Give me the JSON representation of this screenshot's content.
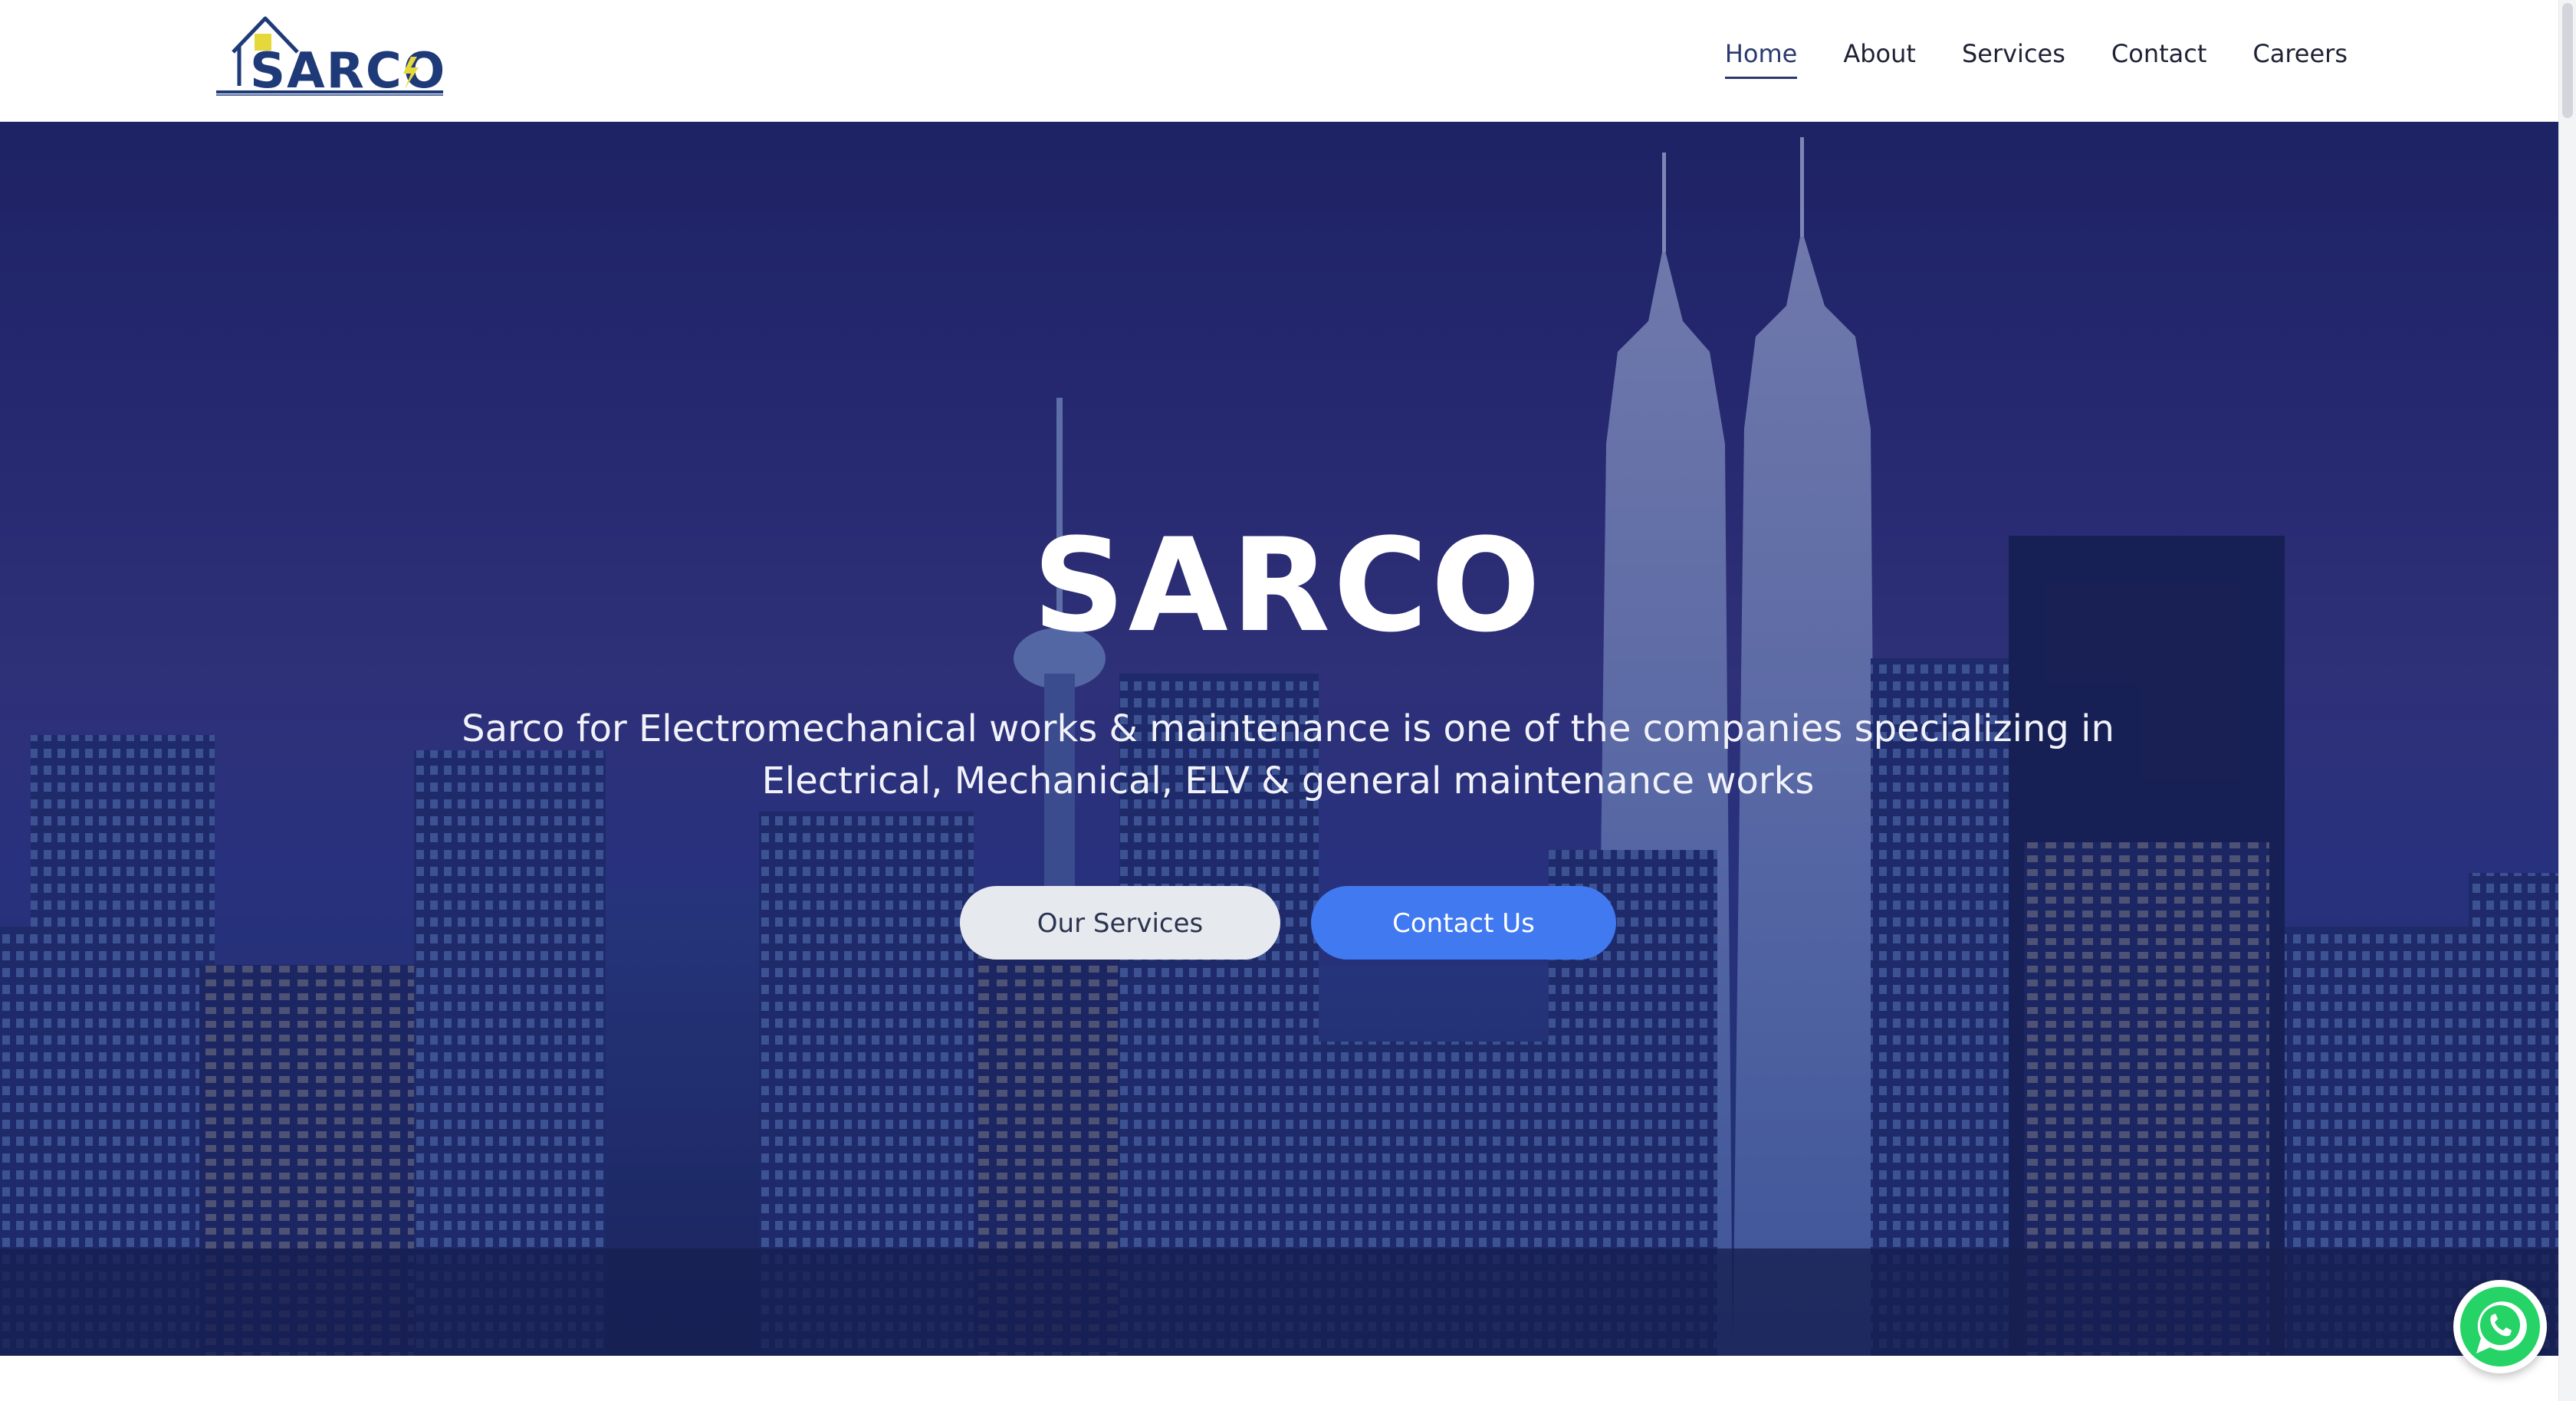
{
  "brand": {
    "logo_text": "SARCO"
  },
  "nav": {
    "items": [
      {
        "label": "Home",
        "active": true
      },
      {
        "label": "About"
      },
      {
        "label": "Services"
      },
      {
        "label": "Contact"
      },
      {
        "label": "Careers"
      }
    ]
  },
  "hero": {
    "title": "SARCO",
    "subtitle": "Sarco for Electromechanical works & maintenance is one of the companies specializing in Electrical, Mechanical, ELV & general maintenance works",
    "primary_button": "Our Services",
    "secondary_button": "Contact Us"
  },
  "floating": {
    "icon": "whatsapp-icon",
    "color": "#25d366"
  },
  "colors": {
    "accent": "#4079f0",
    "nav_active": "#2b3a6e",
    "logo_navy": "#1f3a78",
    "logo_yellow": "#e5d83a"
  }
}
